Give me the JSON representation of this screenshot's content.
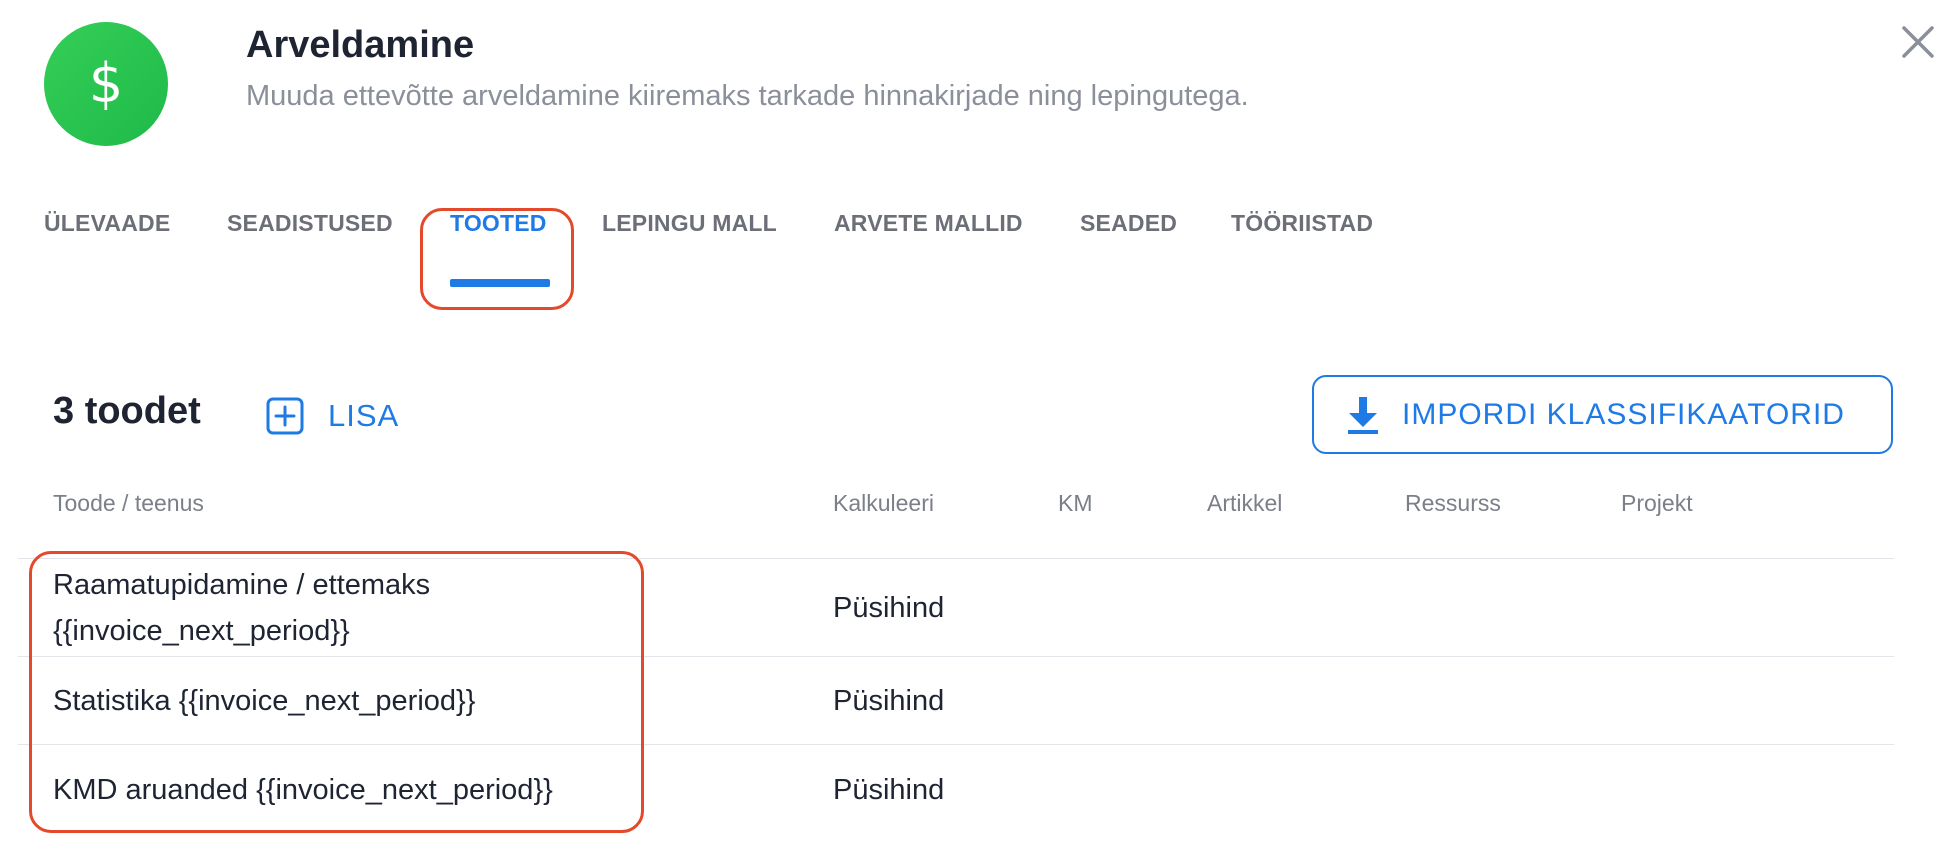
{
  "header": {
    "icon_symbol": "$",
    "icon_name": "dollar-icon",
    "icon_color": "#2cc64f",
    "title": "Arveldamine",
    "subtitle": "Muuda ettevõtte arveldamine kiiremaks tarkade hinnakirjade ning lepingutega."
  },
  "tabs": [
    {
      "label": "ÜLEVAADE"
    },
    {
      "label": "SEADISTUSED"
    },
    {
      "label": "TOOTED",
      "active": true
    },
    {
      "label": "LEPINGU MALL"
    },
    {
      "label": "ARVETE MALLID"
    },
    {
      "label": "SEADED"
    },
    {
      "label": "TÖÖRIISTAD"
    }
  ],
  "toolbar": {
    "count_label": "3 toodet",
    "add_label": "LISA",
    "import_label": "IMPORDI KLASSIFIKAATORID"
  },
  "table": {
    "headers": [
      "Toode / teenus",
      "Kalkuleeri",
      "KM",
      "Artikkel",
      "Ressurss",
      "Projekt"
    ],
    "rows": [
      {
        "name": "Raamatupidamine / ettemaks {{invoice_next_period}}",
        "calc": "Püsihind",
        "km": "",
        "article": "",
        "resource": "",
        "project": ""
      },
      {
        "name": "Statistika {{invoice_next_period}}",
        "calc": "Püsihind",
        "km": "",
        "article": "",
        "resource": "",
        "project": ""
      },
      {
        "name": "KMD aruanded {{invoice_next_period}}",
        "calc": "Püsihind",
        "km": "",
        "article": "",
        "resource": "",
        "project": ""
      }
    ]
  },
  "colors": {
    "accent": "#1e7be6",
    "highlight": "#e4492b",
    "text": "#1f2433",
    "muted": "#8a8f9a"
  }
}
